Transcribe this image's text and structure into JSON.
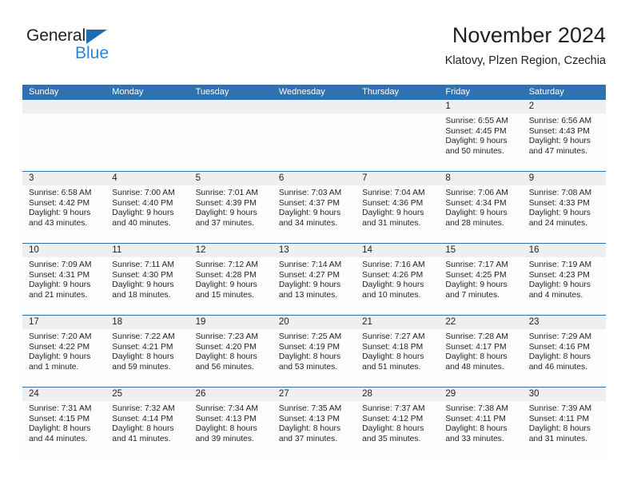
{
  "brand": {
    "name_part1": "General",
    "name_part2": "Blue",
    "triangle_color": "#1f6cb4",
    "blue_color": "#2b87d4"
  },
  "header": {
    "title": "November 2024",
    "subtitle": "Klatovy, Plzen Region, Czechia"
  },
  "theme": {
    "header_blue": "#3071b0",
    "daynum_band": "#efefef",
    "text": "#231f20"
  },
  "weekdays": [
    "Sunday",
    "Monday",
    "Tuesday",
    "Wednesday",
    "Thursday",
    "Friday",
    "Saturday"
  ],
  "weeks": [
    [
      {
        "day": "",
        "sunrise": "",
        "sunset": "",
        "daylight_line1": "",
        "daylight_line2": ""
      },
      {
        "day": "",
        "sunrise": "",
        "sunset": "",
        "daylight_line1": "",
        "daylight_line2": ""
      },
      {
        "day": "",
        "sunrise": "",
        "sunset": "",
        "daylight_line1": "",
        "daylight_line2": ""
      },
      {
        "day": "",
        "sunrise": "",
        "sunset": "",
        "daylight_line1": "",
        "daylight_line2": ""
      },
      {
        "day": "",
        "sunrise": "",
        "sunset": "",
        "daylight_line1": "",
        "daylight_line2": ""
      },
      {
        "day": "1",
        "sunrise": "Sunrise: 6:55 AM",
        "sunset": "Sunset: 4:45 PM",
        "daylight_line1": "Daylight: 9 hours",
        "daylight_line2": "and 50 minutes."
      },
      {
        "day": "2",
        "sunrise": "Sunrise: 6:56 AM",
        "sunset": "Sunset: 4:43 PM",
        "daylight_line1": "Daylight: 9 hours",
        "daylight_line2": "and 47 minutes."
      }
    ],
    [
      {
        "day": "3",
        "sunrise": "Sunrise: 6:58 AM",
        "sunset": "Sunset: 4:42 PM",
        "daylight_line1": "Daylight: 9 hours",
        "daylight_line2": "and 43 minutes."
      },
      {
        "day": "4",
        "sunrise": "Sunrise: 7:00 AM",
        "sunset": "Sunset: 4:40 PM",
        "daylight_line1": "Daylight: 9 hours",
        "daylight_line2": "and 40 minutes."
      },
      {
        "day": "5",
        "sunrise": "Sunrise: 7:01 AM",
        "sunset": "Sunset: 4:39 PM",
        "daylight_line1": "Daylight: 9 hours",
        "daylight_line2": "and 37 minutes."
      },
      {
        "day": "6",
        "sunrise": "Sunrise: 7:03 AM",
        "sunset": "Sunset: 4:37 PM",
        "daylight_line1": "Daylight: 9 hours",
        "daylight_line2": "and 34 minutes."
      },
      {
        "day": "7",
        "sunrise": "Sunrise: 7:04 AM",
        "sunset": "Sunset: 4:36 PM",
        "daylight_line1": "Daylight: 9 hours",
        "daylight_line2": "and 31 minutes."
      },
      {
        "day": "8",
        "sunrise": "Sunrise: 7:06 AM",
        "sunset": "Sunset: 4:34 PM",
        "daylight_line1": "Daylight: 9 hours",
        "daylight_line2": "and 28 minutes."
      },
      {
        "day": "9",
        "sunrise": "Sunrise: 7:08 AM",
        "sunset": "Sunset: 4:33 PM",
        "daylight_line1": "Daylight: 9 hours",
        "daylight_line2": "and 24 minutes."
      }
    ],
    [
      {
        "day": "10",
        "sunrise": "Sunrise: 7:09 AM",
        "sunset": "Sunset: 4:31 PM",
        "daylight_line1": "Daylight: 9 hours",
        "daylight_line2": "and 21 minutes."
      },
      {
        "day": "11",
        "sunrise": "Sunrise: 7:11 AM",
        "sunset": "Sunset: 4:30 PM",
        "daylight_line1": "Daylight: 9 hours",
        "daylight_line2": "and 18 minutes."
      },
      {
        "day": "12",
        "sunrise": "Sunrise: 7:12 AM",
        "sunset": "Sunset: 4:28 PM",
        "daylight_line1": "Daylight: 9 hours",
        "daylight_line2": "and 15 minutes."
      },
      {
        "day": "13",
        "sunrise": "Sunrise: 7:14 AM",
        "sunset": "Sunset: 4:27 PM",
        "daylight_line1": "Daylight: 9 hours",
        "daylight_line2": "and 13 minutes."
      },
      {
        "day": "14",
        "sunrise": "Sunrise: 7:16 AM",
        "sunset": "Sunset: 4:26 PM",
        "daylight_line1": "Daylight: 9 hours",
        "daylight_line2": "and 10 minutes."
      },
      {
        "day": "15",
        "sunrise": "Sunrise: 7:17 AM",
        "sunset": "Sunset: 4:25 PM",
        "daylight_line1": "Daylight: 9 hours",
        "daylight_line2": "and 7 minutes."
      },
      {
        "day": "16",
        "sunrise": "Sunrise: 7:19 AM",
        "sunset": "Sunset: 4:23 PM",
        "daylight_line1": "Daylight: 9 hours",
        "daylight_line2": "and 4 minutes."
      }
    ],
    [
      {
        "day": "17",
        "sunrise": "Sunrise: 7:20 AM",
        "sunset": "Sunset: 4:22 PM",
        "daylight_line1": "Daylight: 9 hours",
        "daylight_line2": "and 1 minute."
      },
      {
        "day": "18",
        "sunrise": "Sunrise: 7:22 AM",
        "sunset": "Sunset: 4:21 PM",
        "daylight_line1": "Daylight: 8 hours",
        "daylight_line2": "and 59 minutes."
      },
      {
        "day": "19",
        "sunrise": "Sunrise: 7:23 AM",
        "sunset": "Sunset: 4:20 PM",
        "daylight_line1": "Daylight: 8 hours",
        "daylight_line2": "and 56 minutes."
      },
      {
        "day": "20",
        "sunrise": "Sunrise: 7:25 AM",
        "sunset": "Sunset: 4:19 PM",
        "daylight_line1": "Daylight: 8 hours",
        "daylight_line2": "and 53 minutes."
      },
      {
        "day": "21",
        "sunrise": "Sunrise: 7:27 AM",
        "sunset": "Sunset: 4:18 PM",
        "daylight_line1": "Daylight: 8 hours",
        "daylight_line2": "and 51 minutes."
      },
      {
        "day": "22",
        "sunrise": "Sunrise: 7:28 AM",
        "sunset": "Sunset: 4:17 PM",
        "daylight_line1": "Daylight: 8 hours",
        "daylight_line2": "and 48 minutes."
      },
      {
        "day": "23",
        "sunrise": "Sunrise: 7:29 AM",
        "sunset": "Sunset: 4:16 PM",
        "daylight_line1": "Daylight: 8 hours",
        "daylight_line2": "and 46 minutes."
      }
    ],
    [
      {
        "day": "24",
        "sunrise": "Sunrise: 7:31 AM",
        "sunset": "Sunset: 4:15 PM",
        "daylight_line1": "Daylight: 8 hours",
        "daylight_line2": "and 44 minutes."
      },
      {
        "day": "25",
        "sunrise": "Sunrise: 7:32 AM",
        "sunset": "Sunset: 4:14 PM",
        "daylight_line1": "Daylight: 8 hours",
        "daylight_line2": "and 41 minutes."
      },
      {
        "day": "26",
        "sunrise": "Sunrise: 7:34 AM",
        "sunset": "Sunset: 4:13 PM",
        "daylight_line1": "Daylight: 8 hours",
        "daylight_line2": "and 39 minutes."
      },
      {
        "day": "27",
        "sunrise": "Sunrise: 7:35 AM",
        "sunset": "Sunset: 4:13 PM",
        "daylight_line1": "Daylight: 8 hours",
        "daylight_line2": "and 37 minutes."
      },
      {
        "day": "28",
        "sunrise": "Sunrise: 7:37 AM",
        "sunset": "Sunset: 4:12 PM",
        "daylight_line1": "Daylight: 8 hours",
        "daylight_line2": "and 35 minutes."
      },
      {
        "day": "29",
        "sunrise": "Sunrise: 7:38 AM",
        "sunset": "Sunset: 4:11 PM",
        "daylight_line1": "Daylight: 8 hours",
        "daylight_line2": "and 33 minutes."
      },
      {
        "day": "30",
        "sunrise": "Sunrise: 7:39 AM",
        "sunset": "Sunset: 4:11 PM",
        "daylight_line1": "Daylight: 8 hours",
        "daylight_line2": "and 31 minutes."
      }
    ]
  ]
}
